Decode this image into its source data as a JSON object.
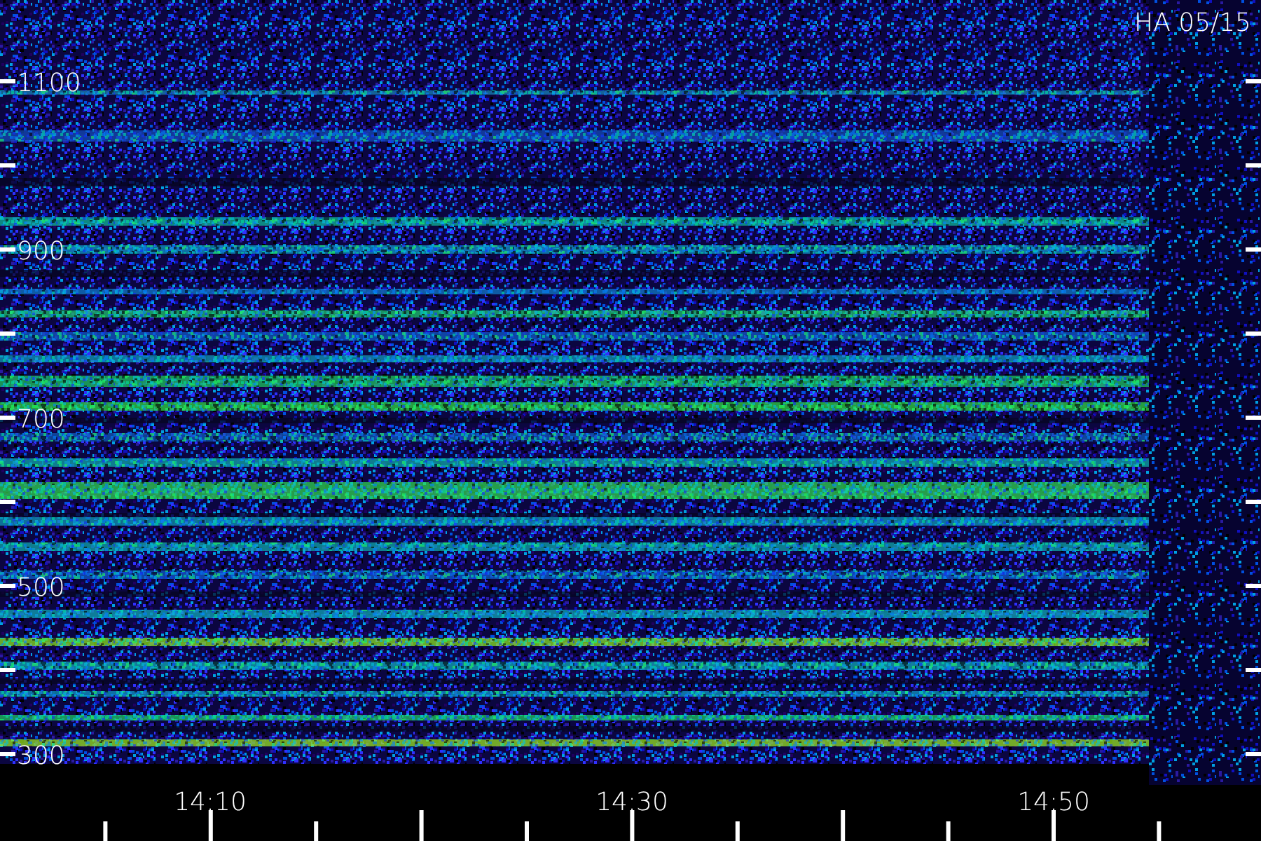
{
  "title": "HA 05/15",
  "y_axis": {
    "labels": [
      "1100",
      "900",
      "700",
      "500",
      "300"
    ]
  },
  "x_axis": {
    "labels": [
      "14:10",
      "14:30",
      "14:50"
    ]
  }
}
